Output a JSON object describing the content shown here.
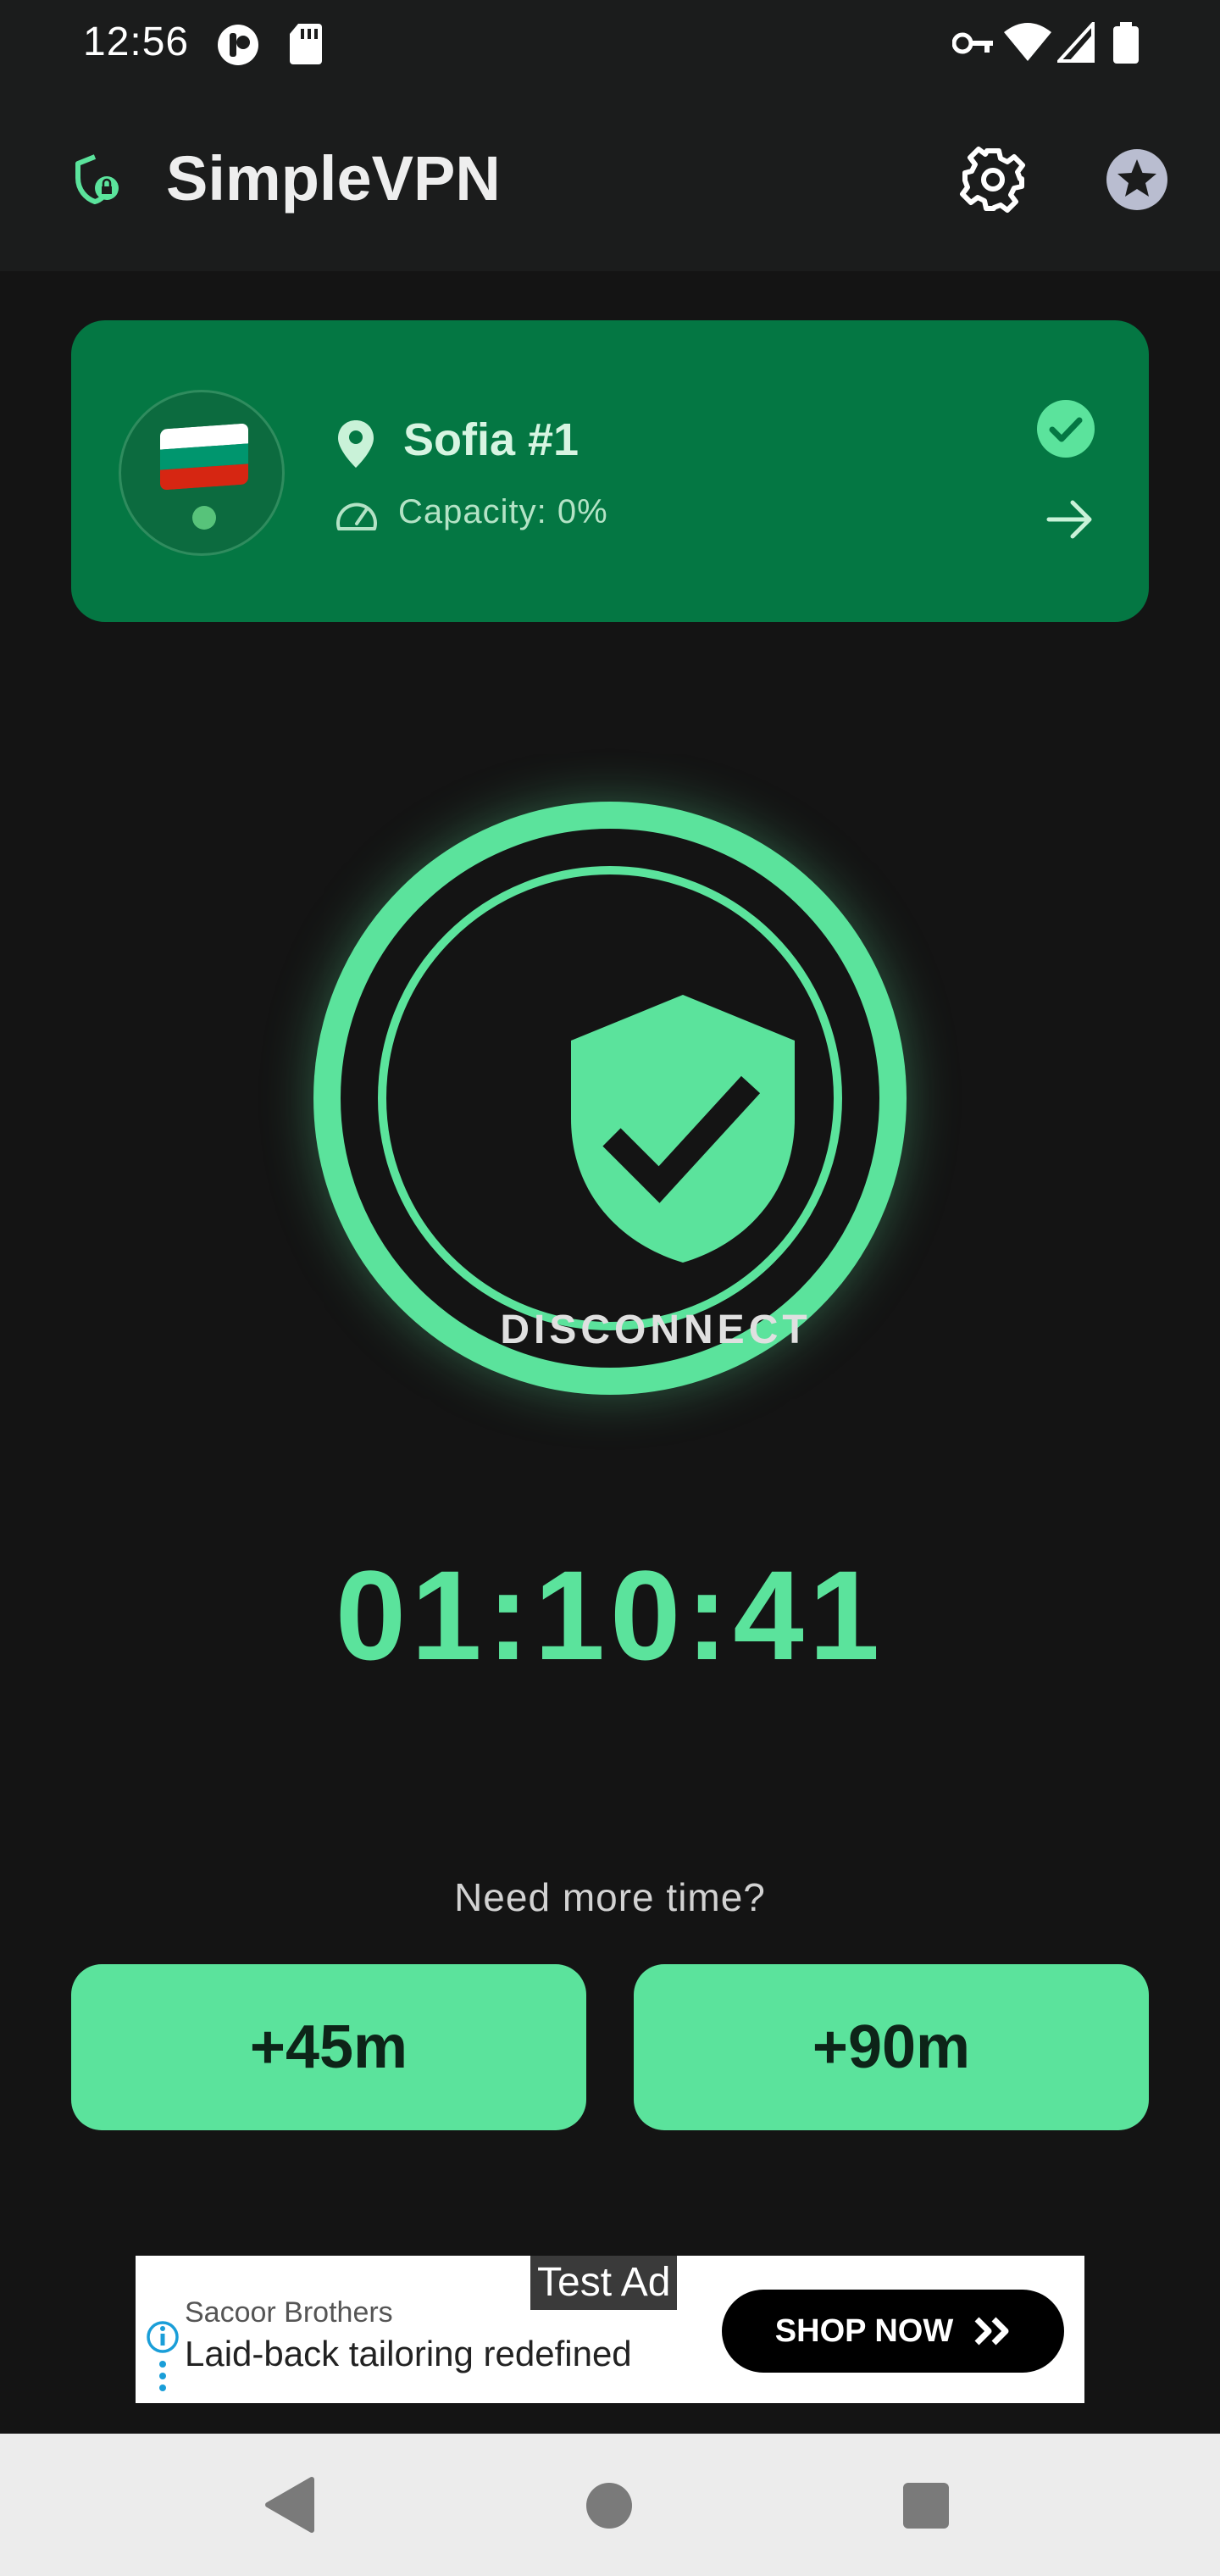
{
  "status_bar": {
    "time": "12:56"
  },
  "app_bar": {
    "title": "SimpleVPN"
  },
  "server": {
    "name": "Sofia #1",
    "capacity": "Capacity: 0%",
    "flag_colors": [
      "#ffffff",
      "#00966e",
      "#d62612"
    ]
  },
  "connect": {
    "button_label": "DISCONNECT",
    "state": "connected"
  },
  "timer": "01:10:41",
  "extend": {
    "prompt": "Need more time?",
    "option_45": "+45m",
    "option_90": "+90m"
  },
  "ad": {
    "badge": "Test Ad",
    "advertiser": "Sacoor Brothers",
    "headline": "Laid-back tailoring redefined",
    "cta": "SHOP NOW",
    "cta_icon": "double-chevron-right-icon"
  },
  "colors": {
    "accent": "#5be39c",
    "card": "#047743",
    "background": "#141414",
    "bar": "#1b1c1c"
  }
}
